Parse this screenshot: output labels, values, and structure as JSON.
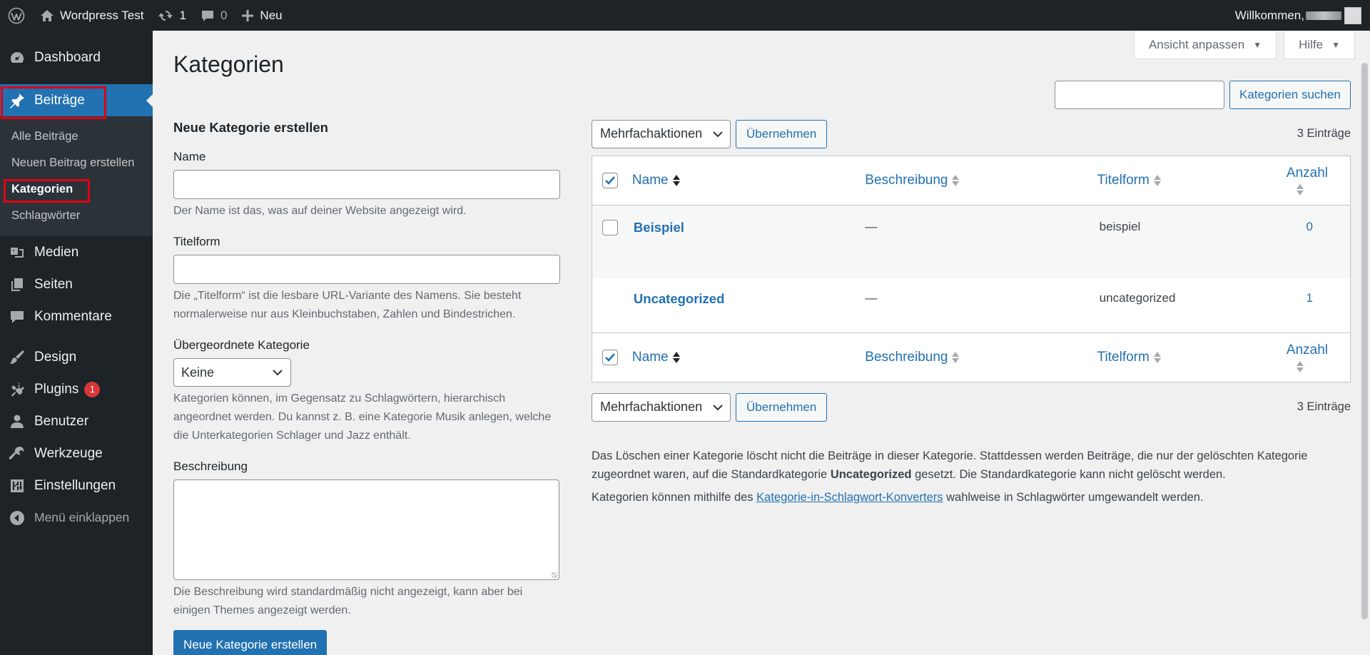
{
  "adminbar": {
    "site_name": "Wordpress Test",
    "updates_count": "1",
    "comments_count": "0",
    "new_label": "Neu",
    "welcome": "Willkommen,"
  },
  "sidebar": {
    "dashboard": "Dashboard",
    "posts": "Beiträge",
    "submenu": {
      "all_posts": "Alle Beiträge",
      "new_post": "Neuen Beitrag erstellen",
      "categories": "Kategorien",
      "tags": "Schlagwörter"
    },
    "media": "Medien",
    "pages": "Seiten",
    "comments": "Kommentare",
    "design": "Design",
    "plugins": "Plugins",
    "plugins_badge": "1",
    "users": "Benutzer",
    "tools": "Werkzeuge",
    "settings": "Einstellungen",
    "collapse": "Menü einklappen"
  },
  "screen_meta": {
    "screen_options": "Ansicht anpassen",
    "help": "Hilfe"
  },
  "page_title": "Kategorien",
  "search": {
    "value": "",
    "button": "Kategorien suchen"
  },
  "form": {
    "heading": "Neue Kategorie erstellen",
    "name_label": "Name",
    "name_value": "",
    "name_help": "Der Name ist das, was auf deiner Website angezeigt wird.",
    "slug_label": "Titelform",
    "slug_value": "",
    "slug_help": "Die „Titelform“ ist die lesbare URL-Variante des Namens. Sie besteht normalerweise nur aus Kleinbuchstaben, Zahlen und Bindestrichen.",
    "parent_label": "Übergeordnete Kategorie",
    "parent_selected": "Keine",
    "parent_help": "Kategorien können, im Gegensatz zu Schlagwörtern, hierarchisch angeordnet werden. Du kannst z. B. eine Kategorie Musik anlegen, welche die Unterkategorien Schlager und Jazz enthält.",
    "desc_label": "Beschreibung",
    "desc_value": "",
    "desc_help": "Die Beschreibung wird standardmäßig nicht angezeigt, kann aber bei einigen Themes angezeigt werden.",
    "submit": "Neue Kategorie erstellen"
  },
  "table": {
    "bulk_actions": "Mehrfachaktionen",
    "apply": "Übernehmen",
    "item_count": "3 Einträge",
    "columns": {
      "name": "Name",
      "description": "Beschreibung",
      "slug": "Titelform",
      "count": "Anzahl"
    },
    "rows": [
      {
        "name": "Beispiel",
        "description": "—",
        "slug": "beispiel",
        "count": "0"
      },
      {
        "name": "Uncategorized",
        "description": "—",
        "slug": "uncategorized",
        "count": "1"
      }
    ]
  },
  "notes": {
    "p1_before": "Das Löschen einer Kategorie löscht nicht die Beiträge in dieser Kategorie. Stattdessen werden Beiträge, die nur der gelöschten Kategorie zugeordnet waren, auf die Standardkategorie ",
    "p1_bold": "Uncategorized",
    "p1_after": " gesetzt. Die Standardkategorie kann nicht gelöscht werden.",
    "p2_before": "Kategorien können mithilfe des ",
    "p2_link": "Kategorie-in-Schlagwort-Konverters",
    "p2_after": " wahlweise in Schlagwörter umgewandelt werden."
  },
  "colors": {
    "accent": "#2271b1",
    "adminbar": "#1d2327",
    "highlight_box": "#e00014",
    "badge": "#d63638"
  }
}
